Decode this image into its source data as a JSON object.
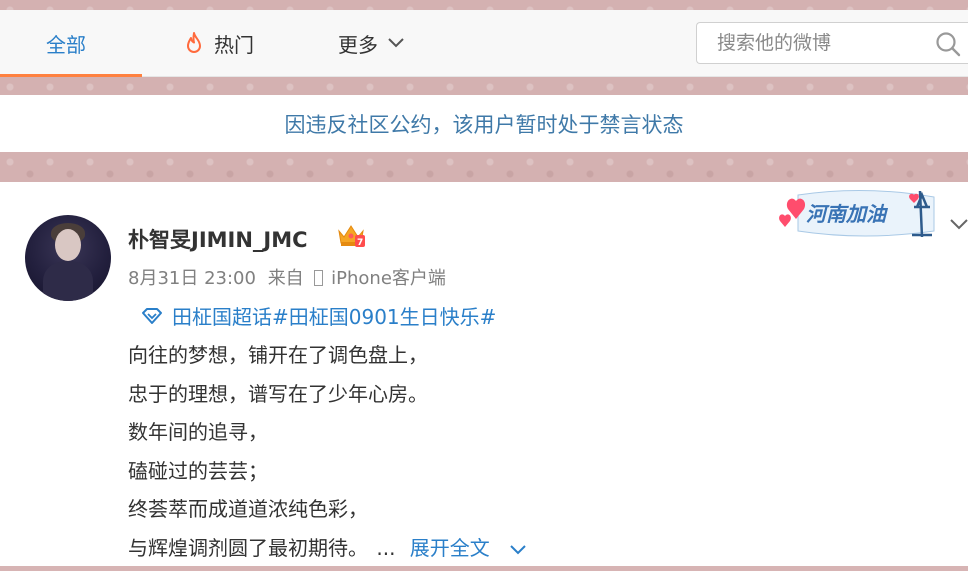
{
  "tabs": {
    "all": "全部",
    "hot": "热门",
    "more": "更多"
  },
  "search": {
    "placeholder": "搜索他的微博"
  },
  "notice": "因违反社区公约，该用户暂时处于禁言状态",
  "post": {
    "username": "朴智旻JIMIN_JMC",
    "time": "8月31日 23:00",
    "via": "来自",
    "client": "iPhone客户端",
    "topic": "田柾国超话#田柾国0901生日快乐#",
    "lines": [
      "向往的梦想，铺开在了调色盘上，",
      "忠于的理想，谱写在了少年心房。",
      "数年间的追寻，",
      "磕碰过的芸芸；",
      "终荟萃而成道道浓纯色彩，",
      "与辉煌调剂圆了最初期待。"
    ],
    "ellipsis": "...",
    "expand": "展开全文",
    "badge_text": "河南加油"
  },
  "colors": {
    "accent": "#2a7fc9",
    "tab_underline": "#ff8140",
    "notice_text": "#3f79a8",
    "hot_icon": "#ff6a3d"
  },
  "icons": [
    "fire-icon",
    "chevron-down-icon",
    "search-icon",
    "crown-icon",
    "topic-diamond-icon",
    "phone-icon"
  ]
}
